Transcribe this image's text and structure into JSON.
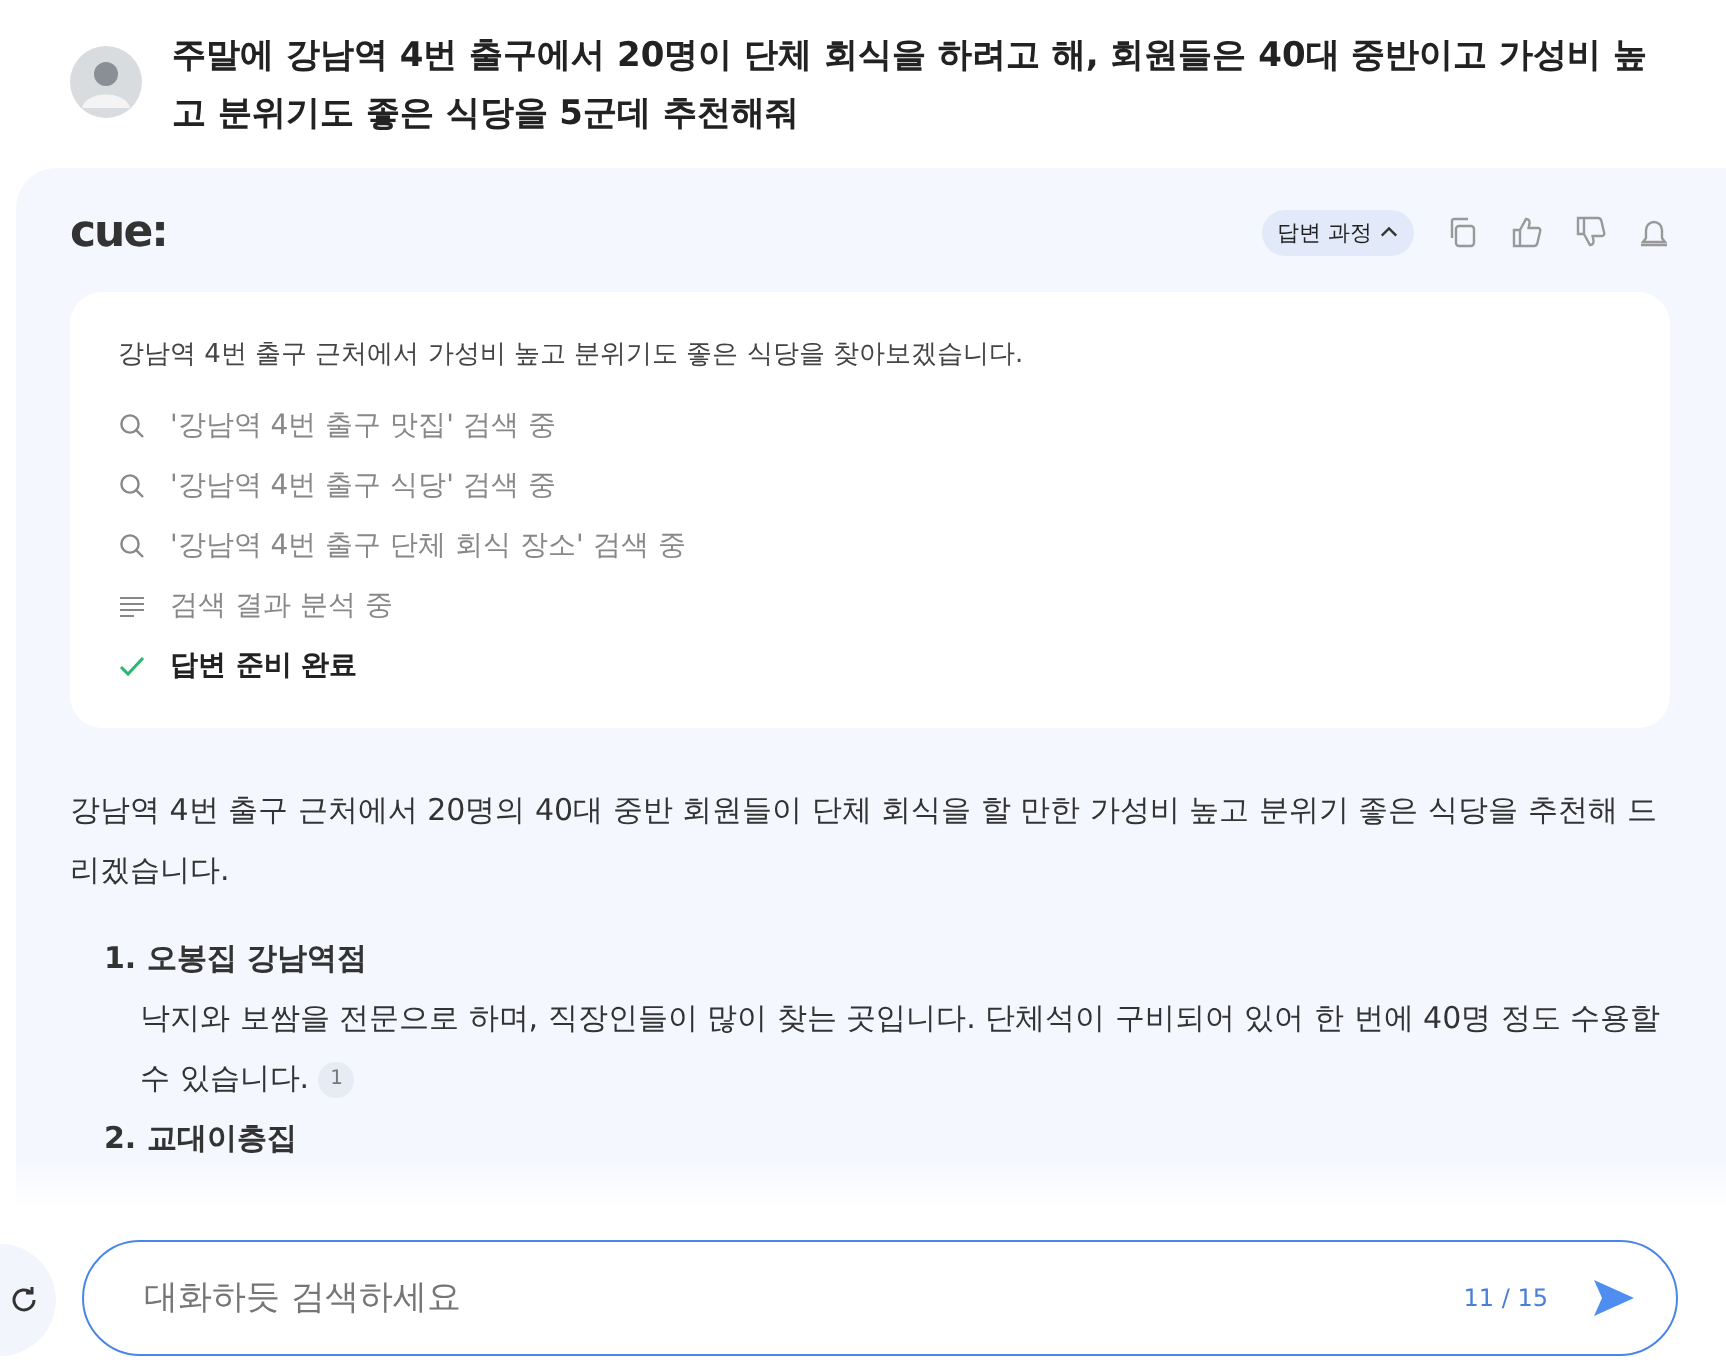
{
  "question": {
    "text": "주말에 강남역 4번 출구에서 20명이 단체 회식을 하려고 해, 회원들은 40대 중반이고 가성비 높고 분위기도 좋은 식당을 5군데 추천해줘"
  },
  "answer": {
    "logo": "cue:",
    "process_button": "답변 과정",
    "steps_intro": "강남역 4번 출구 근처에서 가성비 높고 분위기도 좋은 식당을 찾아보겠습니다.",
    "steps": [
      {
        "kind": "search",
        "text": "'강남역 4번 출구 맛집' 검색 중"
      },
      {
        "kind": "search",
        "text": "'강남역 4번 출구 식당' 검색 중"
      },
      {
        "kind": "search",
        "text": "'강남역 4번 출구 단체 회식 장소' 검색 중"
      },
      {
        "kind": "analyze",
        "text": "검색 결과 분석 중"
      },
      {
        "kind": "done",
        "text": "답변 준비 완료"
      }
    ],
    "intro": "강남역 4번 출구 근처에서 20명의 40대 중반 회원들이 단체 회식을 할 만한 가성비 높고 분위기 좋은 식당을 추천해 드리겠습니다.",
    "items": [
      {
        "number": "1.",
        "name": "오봉집 강남역점",
        "description": "낙지와 보쌈을 전문으로 하며, 직장인들이 많이 찾는 곳입니다. 단체석이 구비되어 있어 한 번에 40명 정도 수용할 수 있습니다.",
        "source": "1"
      },
      {
        "number": "2.",
        "name": "교대이층집"
      }
    ]
  },
  "input": {
    "placeholder": "대화하듯 검색하세요",
    "counter": "11 / 15"
  }
}
